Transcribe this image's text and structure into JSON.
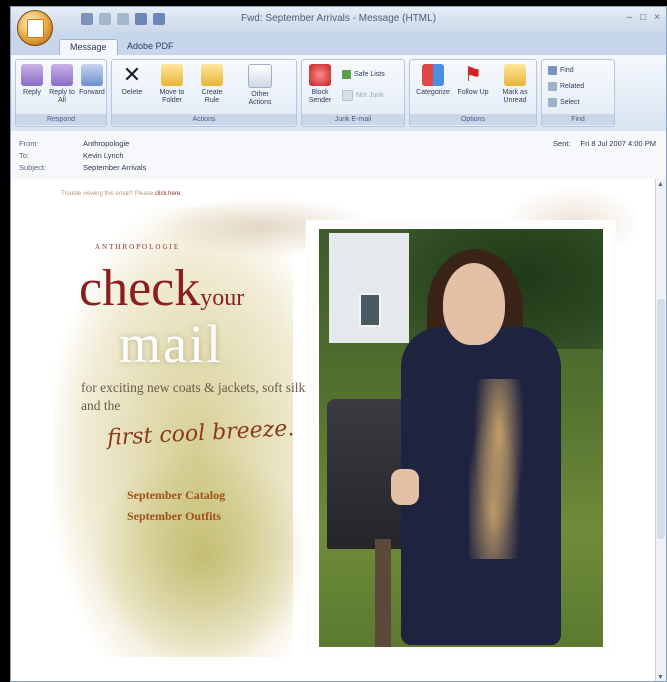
{
  "window": {
    "title": "Fwd: September Arrivals - Message (HTML)",
    "controls": [
      "–",
      "□",
      "×"
    ]
  },
  "tabs": [
    {
      "label": "Message"
    },
    {
      "label": "Adobe PDF"
    }
  ],
  "ribbon": {
    "respond": {
      "label": "Respond",
      "buttons": [
        "Reply",
        "Reply to All",
        "Forward"
      ]
    },
    "actions": {
      "label": "Actions",
      "buttons": [
        "Delete",
        "Move to Folder",
        "Create Rule",
        "Other Actions"
      ]
    },
    "junk": {
      "label": "Junk E-mail",
      "buttons": [
        "Block Sender"
      ],
      "small": [
        "Safe Lists",
        "Not Junk"
      ]
    },
    "options": {
      "label": "Options",
      "buttons": [
        "Categorize",
        "Follow Up",
        "Mark as Unread"
      ]
    },
    "find": {
      "label": "Find",
      "small": [
        "Find",
        "Related",
        "Select"
      ]
    }
  },
  "header": {
    "from_label": "From:",
    "from_value": "Anthropologie",
    "to_label": "To:",
    "to_value": "Kevin Lynch",
    "subject_label": "Subject:",
    "subject_value": "September Arrivals",
    "sent_label": "Sent:",
    "sent_value": "Fri 8 Jul 2007 4:00 PM"
  },
  "email": {
    "preheader": "Trouble viewing this email? Please",
    "preheader_link": "click here.",
    "brand": "ANTHROPOLOGIE",
    "headline_check": "check",
    "headline_your": "your",
    "headline_mail": "mail",
    "copy": "for exciting new coats & jackets, soft silks and the",
    "script": "first cool breeze.",
    "link1": "September Catalog",
    "link2": "September Outfits"
  }
}
